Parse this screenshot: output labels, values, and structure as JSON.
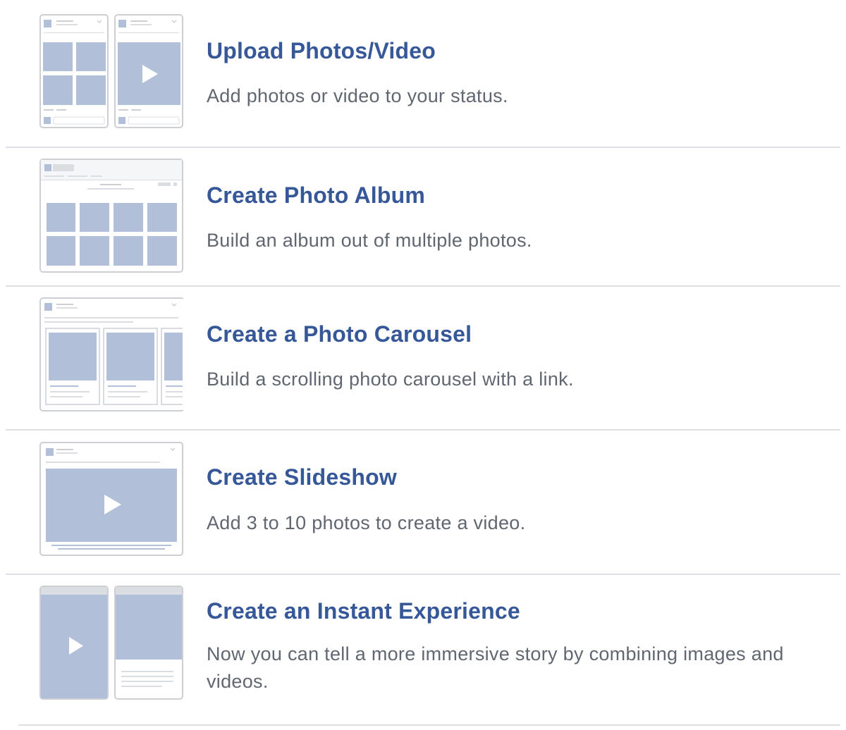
{
  "colors": {
    "title": "#365899",
    "description": "#606770",
    "divider": "#dddfe2",
    "placeholder_block": "#b1bfd9",
    "frame_border": "#ccd0d5",
    "skeleton_line": "#dadde1"
  },
  "options": [
    {
      "id": "upload-photos-video",
      "icon": "upload-photos-video-illustration-icon",
      "title": "Upload Photos/Video",
      "description": "Add photos or video to your status."
    },
    {
      "id": "create-photo-album",
      "icon": "photo-album-illustration-icon",
      "title": "Create Photo Album",
      "description": "Build an album out of multiple photos."
    },
    {
      "id": "create-photo-carousel",
      "icon": "photo-carousel-illustration-icon",
      "title": "Create a Photo Carousel",
      "description": "Build a scrolling photo carousel with a link."
    },
    {
      "id": "create-slideshow",
      "icon": "slideshow-illustration-icon",
      "title": "Create Slideshow",
      "description": "Add 3 to 10 photos to create a video."
    },
    {
      "id": "create-instant-experience",
      "icon": "instant-experience-illustration-icon",
      "title": "Create an Instant Experience",
      "description": "Now you can tell a more immersive story by combining images and videos."
    }
  ]
}
